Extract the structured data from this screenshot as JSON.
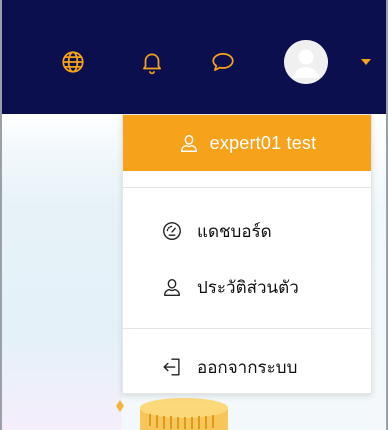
{
  "navbar": {
    "icons": [
      {
        "name": "globe-icon"
      },
      {
        "name": "bell-icon"
      },
      {
        "name": "chat-bubble-icon"
      }
    ],
    "accent_color": "#f7a21b",
    "background_color": "#0b0f4d"
  },
  "user_menu": {
    "user_name": "expert01 test",
    "header_icon": "user-icon",
    "items": [
      {
        "label": "แดชบอร์ด",
        "icon": "dashboard-gauge-icon"
      },
      {
        "label": "ประวัติส่วนตัว",
        "icon": "user-icon"
      },
      {
        "label": "ออกจากระบบ",
        "icon": "logout-icon"
      }
    ]
  }
}
